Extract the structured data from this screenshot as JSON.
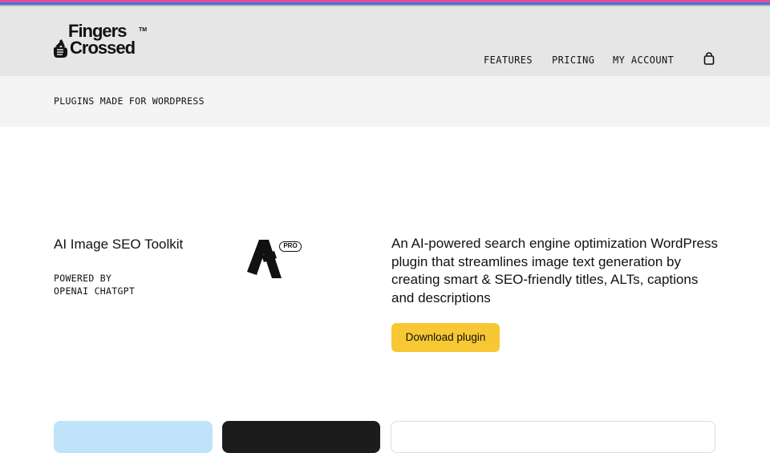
{
  "colors": {
    "accent_yellow": "#f7c833",
    "header_bg": "#e6e6e6",
    "subbar_bg": "#f4f4f4",
    "stripe_pink": "#e64aa6",
    "stripe_blue": "#3a7bd5",
    "card_blue": "#bfe4f9",
    "card_dark": "#1c1c1c"
  },
  "header": {
    "logo": {
      "line1": "Fingers",
      "line2": "Crossed",
      "trademark": "TM",
      "icon": "crossed-fingers-hand-icon"
    },
    "nav": [
      {
        "label": "FEATURES"
      },
      {
        "label": "PRICING"
      },
      {
        "label": "MY ACCOUNT"
      }
    ],
    "cart_icon": "shopping-bag-icon"
  },
  "subbar": {
    "text": "PLUGINS MADE FOR WORDPRESS"
  },
  "product": {
    "title": "AI Image SEO Toolkit",
    "powered_line1": "POWERED BY",
    "powered_line2": "OPENAI CHATGPT",
    "logo_icon": "plugin-a-logo-icon",
    "badge": "PRO",
    "description": "An AI-powered search engine optimization WordPress plugin that streamlines image text generation by creating smart & SEO-friendly titles, ALTs, captions and descriptions",
    "cta_label": "Download plugin"
  }
}
